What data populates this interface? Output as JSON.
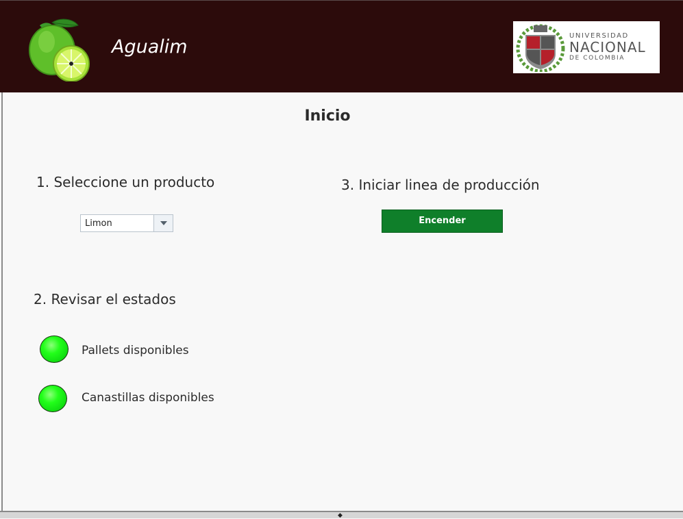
{
  "header": {
    "app_title": "Agualim",
    "logo_icon": "lime-icon",
    "university_logo": {
      "line1": "UNIVERSIDAD",
      "line2": "NACIONAL",
      "line3": "DE COLOMBIA"
    },
    "background_color": "#2c0b0b"
  },
  "main": {
    "page_title": "Inicio",
    "step1": {
      "label": "1. Seleccione un producto",
      "product_select": {
        "value": "Limon",
        "icon": "chevron-down-icon"
      }
    },
    "step2": {
      "label": "2. Revisar el estados",
      "indicators": [
        {
          "label": "Pallets disponibles",
          "status_color": "#22ff1a"
        },
        {
          "label": "Canastillas disponibles",
          "status_color": "#22ff1a"
        }
      ]
    },
    "step3": {
      "label": "3. Iniciar linea de producción",
      "button_label": "Encender",
      "button_color": "#0f7f2a"
    }
  }
}
